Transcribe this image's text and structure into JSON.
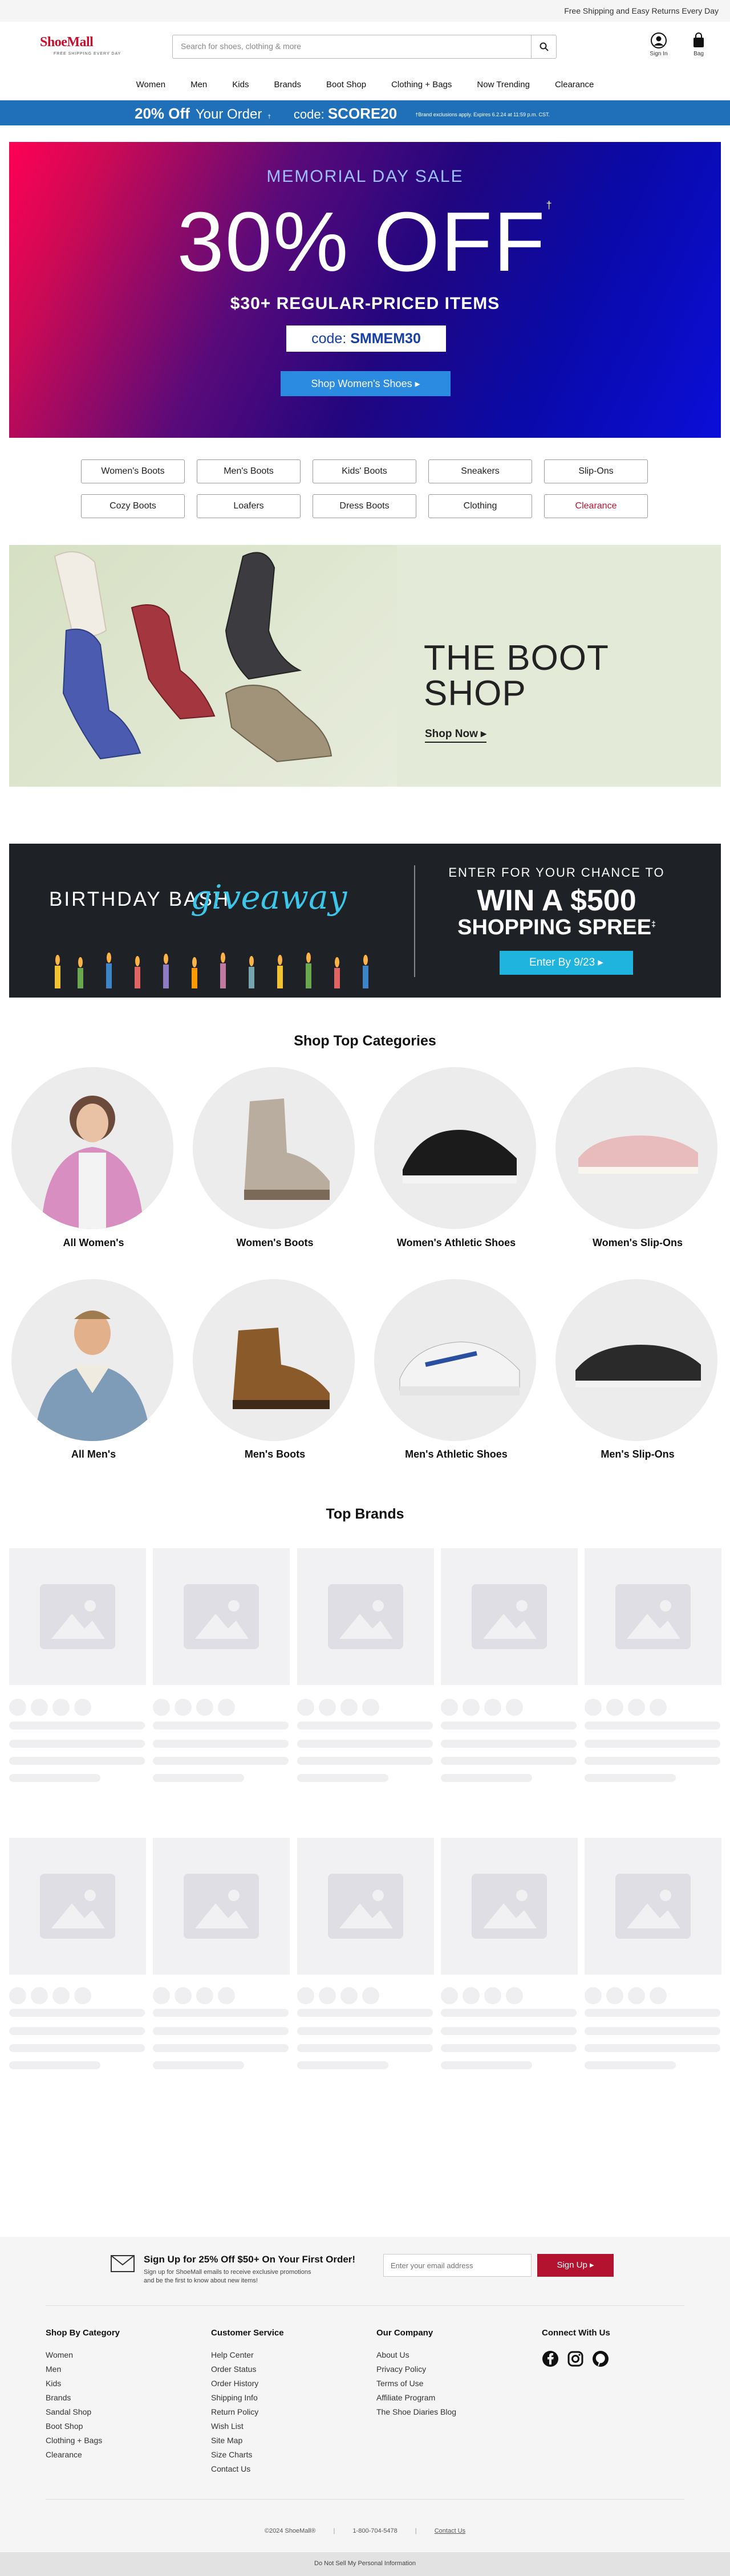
{
  "topbar": {
    "message": "Free Shipping and Easy Returns Every Day"
  },
  "header": {
    "logo_text": "ShoeMall",
    "logo_tagline": "FREE SHIPPING EVERY DAY",
    "search_placeholder": "Search for shoes, clothing & more",
    "signin_label": "Sign In",
    "bag_label": "Bag"
  },
  "nav": {
    "items": [
      "Women",
      "Men",
      "Kids",
      "Brands",
      "Boot Shop",
      "Clothing + Bags",
      "Now Trending",
      "Clearance"
    ]
  },
  "promo": {
    "discount": "20% Off",
    "text": "Your Order",
    "mark": "†",
    "code_label": "code:",
    "code": "SCORE20",
    "fine_print": "†Brand exclusions apply. Expires 6.2.24 at 11:59 p.m. CST."
  },
  "hero": {
    "subtitle": "MEMORIAL DAY SALE",
    "headline": "30% OFF",
    "mark": "†",
    "line": "$30+ REGULAR-PRICED ITEMS",
    "code_label": "code:",
    "code": "SMMEM30",
    "button": "Shop Women's Shoes ▸"
  },
  "pills": {
    "row1": [
      "Women's Boots",
      "Men's Boots",
      "Kids' Boots",
      "Sneakers",
      "Slip-Ons"
    ],
    "row2": [
      "Cozy Boots",
      "Loafers",
      "Dress Boots",
      "Clothing",
      "Clearance"
    ]
  },
  "boot_shop": {
    "title_line1": "THE BOOT",
    "title_line2": "SHOP",
    "link": "Shop Now ▸"
  },
  "giveaway": {
    "title": "BIRTHDAY BASH",
    "script": "giveaway",
    "enter": "ENTER FOR YOUR CHANCE TO",
    "win": "WIN A $500",
    "spree": "SHOPPING SPREE",
    "mark": "‡",
    "button": "Enter By 9/23 ▸"
  },
  "top_categories": {
    "title": "Shop Top Categories",
    "items": [
      "All Women's",
      "Women's Boots",
      "Women's Athletic Shoes",
      "Women's Slip-Ons",
      "All Men's",
      "Men's Boots",
      "Men's Athletic Shoes",
      "Men's Slip-Ons"
    ]
  },
  "top_brands": {
    "title": "Top Brands"
  },
  "footer": {
    "signup_title": "Sign Up for 25% Off $50+ On Your First Order!",
    "signup_desc_line1": "Sign up for ShoeMall emails to receive exclusive promotions",
    "signup_desc_line2": "and be the first to know about new items!",
    "email_placeholder": "Enter your email address",
    "signup_button": "Sign Up ▸",
    "col1_title": "Shop By Category",
    "col1_items": [
      "Women",
      "Men",
      "Kids",
      "Brands",
      "Sandal Shop",
      "Boot Shop",
      "Clothing + Bags",
      "Clearance"
    ],
    "col2_title": "Customer Service",
    "col2_items": [
      "Help Center",
      "Order Status",
      "Order History",
      "Shipping Info",
      "Return Policy",
      "Wish List",
      "Site Map",
      "Size Charts",
      "Contact Us"
    ],
    "col3_title": "Our Company",
    "col3_items": [
      "About Us",
      "Privacy Policy",
      "Terms of Use",
      "Affiliate Program",
      "The Shoe Diaries Blog"
    ],
    "col4_title": "Connect With Us",
    "copyright": "©2024 ShoeMall®",
    "phone": "1-800-704-5478",
    "contact": "Contact Us",
    "bottom": "Do Not Sell My Personal Information"
  },
  "colors": {
    "brand_red": "#c8102e",
    "promo_blue": "#1f6fb9",
    "cta_blue": "#2b8be0",
    "giveaway_cyan": "#1fb4de"
  }
}
